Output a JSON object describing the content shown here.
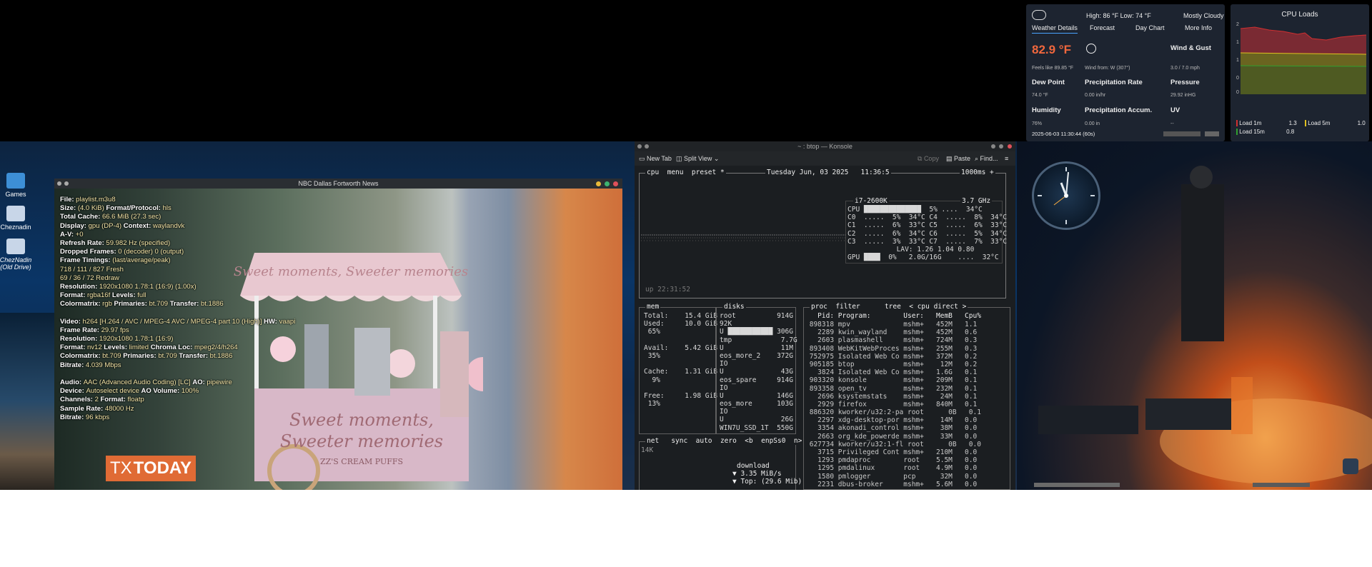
{
  "desktop": {
    "icons": [
      {
        "label": "Games",
        "icon": "folder-icon"
      },
      {
        "label": "Cheznadin",
        "icon": "drive-icon"
      },
      {
        "label": "ChezNadin\n(Old Drive)",
        "icon": "drive-icon"
      }
    ]
  },
  "mpv": {
    "title": "NBC Dallas Fortworth News",
    "stats": [
      {
        "k": "File:",
        "v": "playlist.m3u8"
      },
      {
        "k": "Size:",
        "v": "(4.0 KiB)",
        "k2": "Format/Protocol:",
        "v2": "hls"
      },
      {
        "k": "Total Cache:",
        "v": "66.6 MiB (27.3 sec)"
      },
      {
        "k": "Display:",
        "v": "gpu (DP-4)",
        "k2": "Context:",
        "v2": "waylandvk"
      },
      {
        "k": "A-V:",
        "v": "+0"
      },
      {
        "k": "Refresh Rate:",
        "v": "59.982 Hz (specified)"
      },
      {
        "k": "Dropped Frames:",
        "v": "0 (decoder) 0 (output)"
      },
      {
        "k": "Frame Timings:",
        "v": "(last/average/peak)"
      },
      {
        "k": "",
        "v": "718 /    111 /    827     Fresh"
      },
      {
        "k": "",
        "v": "   69 /     36 /    72     Redraw"
      },
      {
        "k": "Resolution:",
        "v": "1920x1080 1.78:1 (16:9) (1.00x)"
      },
      {
        "k": "Format:",
        "v": "rgba16f",
        "k2": "Levels:",
        "v2": "full"
      },
      {
        "k": "Colormatrix:",
        "v": "rgb",
        "k2": "Primaries:",
        "v2": "bt.709",
        "k3": "Transfer:",
        "v3": "bt.1886"
      },
      {
        "k": "",
        "v": ""
      },
      {
        "k": "Video:",
        "v": "h264 [H.264 / AVC / MPEG-4 AVC / MPEG-4 part 10 (High)]",
        "k2": "HW:",
        "v2": "vaapi"
      },
      {
        "k": "Frame Rate:",
        "v": "29.97 fps"
      },
      {
        "k": "Resolution:",
        "v": "1920x1080 1.78:1 (16:9)"
      },
      {
        "k": "Format:",
        "v": "nv12",
        "k2": "Levels:",
        "v2": "limited",
        "k3": "Chroma Loc:",
        "v3": "mpeg2/4/h264"
      },
      {
        "k": "Colormatrix:",
        "v": "bt.709",
        "k2": "Primaries:",
        "v2": "bt.709",
        "k3": "Transfer:",
        "v3": "bt.1886"
      },
      {
        "k": "Bitrate:",
        "v": "4.039 Mbps"
      },
      {
        "k": "",
        "v": ""
      },
      {
        "k": "Audio:",
        "v": "AAC (Advanced Audio Coding) [LC]",
        "k2": "AO:",
        "v2": "pipewire"
      },
      {
        "k": "Device:",
        "v": "Autoselect device",
        "k2": "AO Volume:",
        "v2": "100%"
      },
      {
        "k": "Channels:",
        "v": "2",
        "k2": "Format:",
        "v2": "floatp"
      },
      {
        "k": "Sample Rate:",
        "v": "48000 Hz"
      },
      {
        "k": "Bitrate:",
        "v": "96 kbps"
      }
    ],
    "sign_line1": "Sweet moments,",
    "sign_line2": "Sweeter memories",
    "sign_line3": "ZZ'S CREAM PUFFS",
    "canopy_text": "Sweet moments, Sweeter memories",
    "tx_a": "TX",
    "tx_b": "TODAY"
  },
  "konsole": {
    "title": "~ : btop — Konsole",
    "new_tab": "New Tab",
    "split_view": "Split View",
    "copy": "Copy",
    "paste": "Paste",
    "find": "Find...",
    "cpu_header": "cpu  menu  preset *",
    "date_line": "Tuesday Jun, 03 2025   11:36:5",
    "refresh": "1000ms +",
    "cpu_model": "i7-2600K",
    "cpu_ghz": "3.7 GHz",
    "cpu_rows": [
      "CPU ██████████████  5% ....  34°C",
      "C0  .....  5%  34°C C4  .....  8%  34°C",
      "C1  .....  6%  33°C C5  .....  6%  33°C",
      "C2  .....  6%  34°C C6  .....  5%  34°C",
      "C3  .....  3%  33°C C7  .....  7%  33°C",
      "            LAV: 1.26 1.04 0.80",
      "GPU ████  0%   2.0G/16G    ....  32°C"
    ],
    "uptime": "up 22:31:52",
    "mem_header": "mem",
    "mem": [
      "Total:    15.4 GiB",
      "Used:     10.0 GiB",
      " 65%",
      "",
      "Avail:    5.42 GiB",
      " 35%",
      "",
      "Cache:    1.31 GiB",
      "  9%",
      "",
      "Free:     1.98 GiB",
      " 13%"
    ],
    "disks_header": "disks",
    "disks": [
      "root          914G",
      "92K",
      "U ███████████ 306G",
      "tmp            7.7G",
      "U              11M",
      "eos_more_2    372G",
      "IO",
      "U              43G",
      "eos_spare     914G",
      "IO",
      "U             146G",
      "eos_more      103G",
      "IO",
      "U              26G",
      "WIN7U_SSD_1T  550G"
    ],
    "proc_header": "proc  filter      tree  < cpu direct >",
    "proc_cols": "   Pid: Program:        User:   MemB   Cpu%",
    "procs": [
      " 898318 mpv             mshm+   452M   1.1",
      "   2289 kwin_wayland    mshm+   452M   0.6",
      "   2603 plasmashell     mshm+   724M   0.3",
      " 893408 WebKitWebProces mshm+   255M   0.3",
      " 752975 Isolated Web Co mshm+   372M   0.2",
      " 905185 btop            mshm+    12M   0.2",
      "   3824 Isolated Web Co mshm+   1.6G   0.1",
      " 903320 konsole         mshm+   209M   0.1",
      " 893358 open_tv         mshm+   232M   0.1",
      "   2696 ksystemstats    mshm+    24M   0.1",
      "   2929 firefox         mshm+   840M   0.1",
      " 886320 kworker/u32:2-pa root      0B   0.1",
      "   2297 xdg-desktop-por mshm+    14M   0.0",
      "   3354 akonadi_control mshm+    38M   0.0",
      "   2663 org_kde_powerde mshm+    33M   0.0",
      " 627734 kworker/u32:1-fl root      0B   0.0",
      "   3715 Privileged Cont mshm+   210M   0.0",
      "   1293 pmdaproc        root    5.5M   0.0",
      "   1295 pmdalinux       root    4.9M   0.0",
      "   1580 pmlogger        pcp      32M   0.0",
      "   2231 dbus-broker     mshm+   5.6M   0.0"
    ],
    "net_header": "net   sync  auto  zero  <b  enpSs0  n>",
    "net": [
      "14K",
      "download",
      "▼ 3.35 MiB/s",
      "▼ Top: (29.6 Mib)"
    ]
  },
  "weather": {
    "hilo": "High: 86 °F Low: 74 °F",
    "condition": "Mostly Cloudy",
    "tabs": [
      "Weather Details",
      "Forecast",
      "Day Chart",
      "More Info"
    ],
    "temp": "82.9 °F",
    "wind_title": "Wind & Gust",
    "feels": "Feels like 89.85 °F",
    "wind_from": "Wind from: W (307°)",
    "wind_val": "3.0 / 7.0 mph",
    "dew_title": "Dew Point",
    "dew_val": "74.0 °F",
    "precip_title": "Precipitation Rate",
    "precip_val": "0.00 in/hr",
    "pressure_title": "Pressure",
    "pressure_val": "29.92 inHG",
    "humidity_title": "Humidity",
    "humidity_val": "76%",
    "accum_title": "Precipitation Accum.",
    "accum_val": "0.00 in",
    "uv_title": "UV",
    "uv_val": "--",
    "timestamp": "2025-06-03 11:30:44 (60s)",
    "temp_color": "#f0673d"
  },
  "cpu_loads": {
    "title": "CPU Loads",
    "y_ticks": [
      "2",
      "1",
      "1",
      "0",
      "0"
    ],
    "legend": [
      {
        "label": "Load 1m",
        "value": "1.3",
        "color": "#d03030"
      },
      {
        "label": "Load 5m",
        "value": "1.0",
        "color": "#e0c020"
      },
      {
        "label": "Load 15m",
        "value": "0.8",
        "color": "#30a030"
      }
    ]
  }
}
